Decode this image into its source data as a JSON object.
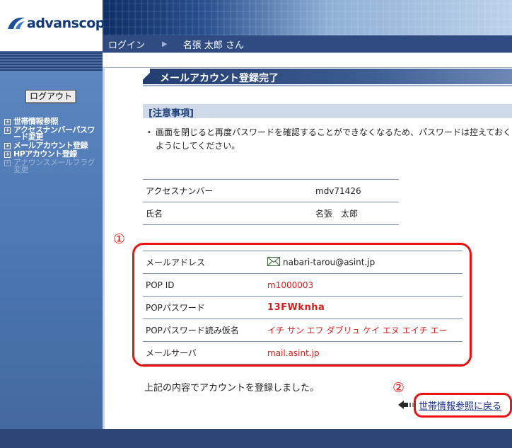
{
  "brand": {
    "logo_text": "advanscope"
  },
  "userbar": {
    "login_label": "ログイン",
    "user_name": "名張 太郎 さん"
  },
  "sidebar": {
    "logout_label": "ログアウト",
    "items": [
      {
        "label": "世帯情報参照",
        "enabled": true
      },
      {
        "label": "アクセスナンバーパスワード変更",
        "enabled": true
      },
      {
        "label": "メールアカウント登録",
        "enabled": true
      },
      {
        "label": "HPアカウント登録",
        "enabled": true
      },
      {
        "label": "アナウンスメールフラグ変更",
        "enabled": false
      }
    ]
  },
  "main": {
    "page_title": "メールアカウント登録完了",
    "notice": {
      "title": "[注意事項]",
      "text": "画面を閉じると再度パスワードを確認することができなくなるため、パスワードは控えておくようにしてください。"
    },
    "user_table": [
      {
        "label": "アクセスナンバー",
        "value": "mdv71426"
      },
      {
        "label": "氏名",
        "value": "名張　太郎"
      }
    ],
    "account_table": [
      {
        "label": "メールアドレス",
        "value": "nabari-tarou@asint.jp"
      },
      {
        "label": "POP ID",
        "value": "m1000003"
      },
      {
        "label": "POPパスワード",
        "value": "13FWknha"
      },
      {
        "label": "POPパスワード読み仮名",
        "value": "イチ サン エフ ダブリュ ケイ エヌ エイチ エー"
      },
      {
        "label": "メールサーバ",
        "value": "mail.asint.jp"
      }
    ],
    "done_message": "上記の内容でアカウントを登録しました。",
    "back_link": "世帯情報参照に戻る"
  },
  "annotations": {
    "mark_1": "①",
    "mark_2": "②"
  },
  "colors": {
    "header_navy": "#2f4b82",
    "sidebar_blue": "#4a74b0",
    "highlight_red": "#e11",
    "value_red": "#d42020"
  }
}
